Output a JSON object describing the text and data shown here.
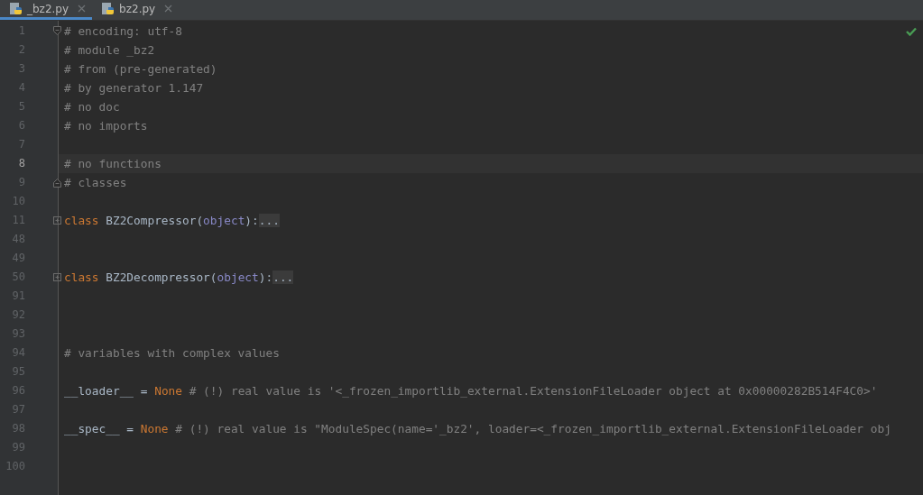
{
  "tabs": [
    {
      "label": "_bz2.py",
      "selected": true
    },
    {
      "label": "bz2.py",
      "selected": false
    }
  ],
  "editor": {
    "lines": [
      {
        "number": "1",
        "kind": "fold_start",
        "current": false,
        "tokens": [
          {
            "kind": "comment",
            "text": "# encoding: utf-8"
          }
        ]
      },
      {
        "number": "2",
        "kind": "code",
        "current": false,
        "tokens": [
          {
            "kind": "comment",
            "text": "# module _bz2"
          }
        ]
      },
      {
        "number": "3",
        "kind": "code",
        "current": false,
        "tokens": [
          {
            "kind": "comment",
            "text": "# from (pre-generated)"
          }
        ]
      },
      {
        "number": "4",
        "kind": "code",
        "current": false,
        "tokens": [
          {
            "kind": "comment",
            "text": "# by generator 1.147"
          }
        ]
      },
      {
        "number": "5",
        "kind": "code",
        "current": false,
        "tokens": [
          {
            "kind": "comment",
            "text": "# no doc"
          }
        ]
      },
      {
        "number": "6",
        "kind": "code",
        "current": false,
        "tokens": [
          {
            "kind": "comment",
            "text": "# no imports"
          }
        ]
      },
      {
        "number": "7",
        "kind": "code",
        "current": false
      },
      {
        "number": "8",
        "kind": "code",
        "current": true,
        "tokens": [
          {
            "kind": "comment",
            "text": "# no functions"
          }
        ]
      },
      {
        "number": "9",
        "kind": "fold_end",
        "current": false,
        "tokens": [
          {
            "kind": "comment",
            "text": "# classes"
          }
        ]
      },
      {
        "number": "10",
        "kind": "code",
        "current": false
      },
      {
        "number": "11",
        "kind": "collapsed",
        "current": false,
        "tokens": [
          {
            "kind": "keyword",
            "text": "class "
          },
          {
            "kind": "plain",
            "text": "BZ2Compressor("
          },
          {
            "kind": "builtin",
            "text": "object"
          },
          {
            "kind": "plain",
            "text": "):"
          },
          {
            "kind": "folded",
            "text": "..."
          }
        ]
      },
      {
        "number": "48",
        "kind": "code",
        "current": false
      },
      {
        "number": "49",
        "kind": "code",
        "current": false
      },
      {
        "number": "50",
        "kind": "collapsed",
        "current": false,
        "tokens": [
          {
            "kind": "keyword",
            "text": "class "
          },
          {
            "kind": "plain",
            "text": "BZ2Decompressor("
          },
          {
            "kind": "builtin",
            "text": "object"
          },
          {
            "kind": "plain",
            "text": "):"
          },
          {
            "kind": "folded",
            "text": "..."
          }
        ]
      },
      {
        "number": "91",
        "kind": "code",
        "current": false
      },
      {
        "number": "92",
        "kind": "code",
        "current": false
      },
      {
        "number": "93",
        "kind": "code",
        "current": false
      },
      {
        "number": "94",
        "kind": "code",
        "current": false,
        "tokens": [
          {
            "kind": "comment",
            "text": "# variables with complex values"
          }
        ]
      },
      {
        "number": "95",
        "kind": "code",
        "current": false
      },
      {
        "number": "96",
        "kind": "code",
        "current": false,
        "tokens": [
          {
            "kind": "plain",
            "text": "__loader__ = "
          },
          {
            "kind": "keyword",
            "text": "None"
          },
          {
            "kind": "comment",
            "text": " # (!) real value is '<_frozen_importlib_external.ExtensionFileLoader object at 0x00000282B514F4C0>'"
          }
        ]
      },
      {
        "number": "97",
        "kind": "code",
        "current": false
      },
      {
        "number": "98",
        "kind": "code",
        "current": false,
        "tokens": [
          {
            "kind": "plain",
            "text": "__spec__ = "
          },
          {
            "kind": "keyword",
            "text": "None"
          },
          {
            "kind": "comment",
            "text": " # (!) real value is \"ModuleSpec(name='_bz2', loader=<_frozen_importlib_external.ExtensionFileLoader obj"
          }
        ]
      },
      {
        "number": "99",
        "kind": "code",
        "current": false
      },
      {
        "number": "100",
        "kind": "code",
        "current": false
      }
    ]
  }
}
